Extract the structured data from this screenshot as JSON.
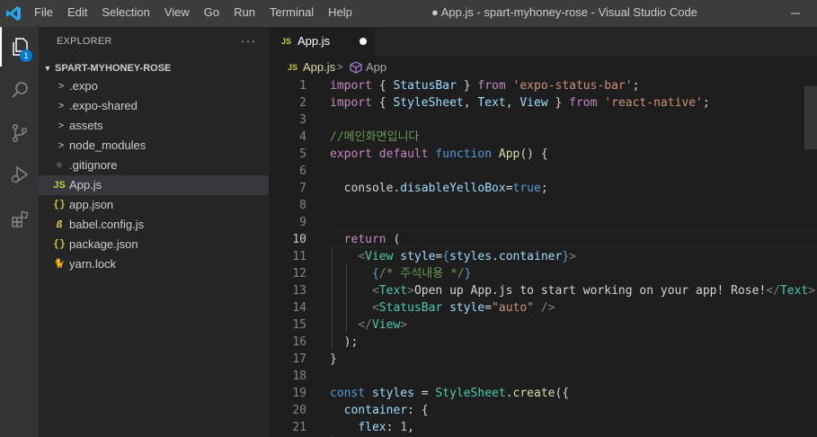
{
  "window": {
    "title": "● App.js - spart-myhoney-rose - Visual Studio Code"
  },
  "menu": [
    "File",
    "Edit",
    "Selection",
    "View",
    "Go",
    "Run",
    "Terminal",
    "Help"
  ],
  "activity": {
    "explorer_badge": "1"
  },
  "explorer": {
    "header": "EXPLORER",
    "more": "···",
    "root": "SPART-MYHONEY-ROSE",
    "items": [
      {
        "label": ".expo",
        "icon": "chevron-right-icon",
        "glyph": ">"
      },
      {
        "label": ".expo-shared",
        "icon": "chevron-right-icon",
        "glyph": ">"
      },
      {
        "label": "assets",
        "icon": "chevron-right-icon",
        "glyph": ">"
      },
      {
        "label": "node_modules",
        "icon": "chevron-right-icon",
        "glyph": ">"
      },
      {
        "label": ".gitignore",
        "icon": "gitignore-file-icon",
        "glyph": "◆"
      },
      {
        "label": "App.js",
        "icon": "js-file-icon",
        "glyph": "JS"
      },
      {
        "label": "app.json",
        "icon": "json-file-icon",
        "glyph": "{}"
      },
      {
        "label": "babel.config.js",
        "icon": "babel-file-icon",
        "glyph": "ß"
      },
      {
        "label": "package.json",
        "icon": "json-file-icon",
        "glyph": "{}"
      },
      {
        "label": "yarn.lock",
        "icon": "yarn-file-icon",
        "glyph": "🐈"
      }
    ],
    "selected_index": 5
  },
  "tab": {
    "icon": "JS",
    "label": "App.js"
  },
  "breadcrumb": {
    "file": "App.js",
    "separator": ">",
    "symbol": "App"
  },
  "editor": {
    "current_line": 10,
    "lines": [
      [
        [
          "import",
          "c"
        ],
        [
          " { ",
          ""
        ],
        [
          "StatusBar",
          "v"
        ],
        [
          " } ",
          ""
        ],
        [
          "from",
          "c"
        ],
        [
          " ",
          ""
        ],
        [
          "'expo-status-bar'",
          "s"
        ],
        [
          ";",
          ""
        ]
      ],
      [
        [
          "import",
          "c"
        ],
        [
          " { ",
          ""
        ],
        [
          "StyleSheet",
          "v"
        ],
        [
          ", ",
          ""
        ],
        [
          "Text",
          "v"
        ],
        [
          ", ",
          ""
        ],
        [
          "View",
          "v"
        ],
        [
          " } ",
          ""
        ],
        [
          "from",
          "c"
        ],
        [
          " ",
          ""
        ],
        [
          "'react-native'",
          "s"
        ],
        [
          ";",
          ""
        ]
      ],
      [],
      [
        [
          "//메인화면입니다",
          "m"
        ]
      ],
      [
        [
          "export",
          "c"
        ],
        [
          " ",
          ""
        ],
        [
          "default",
          "c"
        ],
        [
          " ",
          ""
        ],
        [
          "function",
          "k"
        ],
        [
          " ",
          ""
        ],
        [
          "App",
          "f"
        ],
        [
          "() {",
          ""
        ]
      ],
      [],
      [
        [
          "  console",
          ""
        ],
        [
          ".",
          ""
        ],
        [
          "disableYelloBox",
          "v"
        ],
        [
          "=",
          ""
        ],
        [
          "true",
          "k"
        ],
        [
          ";",
          ""
        ]
      ],
      [],
      [],
      [
        [
          "  ",
          ""
        ],
        [
          "return",
          "c"
        ],
        [
          " (",
          ""
        ]
      ],
      [
        [
          "    ",
          ""
        ],
        [
          "<",
          "g"
        ],
        [
          "View",
          "t"
        ],
        [
          " ",
          ""
        ],
        [
          "style",
          "v"
        ],
        [
          "=",
          ""
        ],
        [
          "{",
          "k"
        ],
        [
          "styles",
          "v"
        ],
        [
          ".",
          ""
        ],
        [
          "container",
          "v"
        ],
        [
          "}",
          "k"
        ],
        [
          ">",
          "g"
        ]
      ],
      [
        [
          "      ",
          ""
        ],
        [
          "{",
          "k"
        ],
        [
          "/* 주석내용 */",
          "m"
        ],
        [
          "}",
          "k"
        ]
      ],
      [
        [
          "      ",
          ""
        ],
        [
          "<",
          "g"
        ],
        [
          "Text",
          "t"
        ],
        [
          ">",
          "g"
        ],
        [
          "Open up App.js to start working on your app! Rose!",
          ""
        ],
        [
          "</",
          "g"
        ],
        [
          "Text",
          "t"
        ],
        [
          ">",
          "g"
        ]
      ],
      [
        [
          "      ",
          ""
        ],
        [
          "<",
          "g"
        ],
        [
          "StatusBar",
          "t"
        ],
        [
          " ",
          ""
        ],
        [
          "style",
          "v"
        ],
        [
          "=",
          ""
        ],
        [
          "\"auto\"",
          "s"
        ],
        [
          " />",
          "g"
        ]
      ],
      [
        [
          "    ",
          ""
        ],
        [
          "</",
          "g"
        ],
        [
          "View",
          "t"
        ],
        [
          ">",
          "g"
        ]
      ],
      [
        [
          "  );",
          ""
        ]
      ],
      [
        [
          "}",
          ""
        ]
      ],
      [],
      [
        [
          "const",
          "k"
        ],
        [
          " ",
          ""
        ],
        [
          "styles",
          "v"
        ],
        [
          " = ",
          ""
        ],
        [
          "StyleSheet",
          "t"
        ],
        [
          ".",
          ""
        ],
        [
          "create",
          "f"
        ],
        [
          "({",
          ""
        ]
      ],
      [
        [
          "  ",
          ""
        ],
        [
          "container",
          "v"
        ],
        [
          ": {",
          ""
        ]
      ],
      [
        [
          "    ",
          ""
        ],
        [
          "flex",
          "v"
        ],
        [
          ": ",
          ""
        ],
        [
          "1",
          "n"
        ],
        [
          ",",
          ""
        ]
      ]
    ]
  }
}
